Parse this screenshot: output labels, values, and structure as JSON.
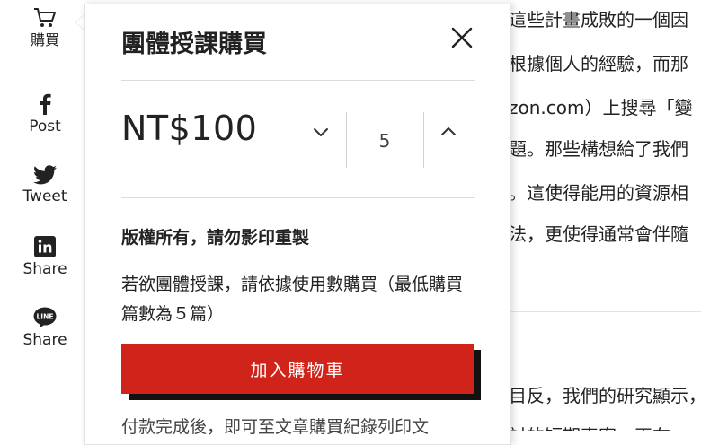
{
  "rail": {
    "cart_label": "購買",
    "facebook_label": "Post",
    "twitter_label": "Tweet",
    "linkedin_label": "Share",
    "line_label": "Share"
  },
  "article": {
    "lines": [
      "這些計畫成敗的一個因",
      "根據個人的經驗，而那",
      "zon.com）上搜尋「變",
      "題。那些構想給了我們",
      "。這使得能用的資源相",
      "法，更使得通常會伴隨",
      "目反，我們的研究顯示，",
      "討的短期專案，再在"
    ]
  },
  "popup": {
    "title": "團體授課購買",
    "price": "NT$100",
    "quantity": "5",
    "copyright_text": "版權所有，請勿影印重製",
    "bulk_text": "若欲團體授課，請依據使用數購買（最低購買篇數為５篇）",
    "add_to_cart_label": "加入購物車",
    "note_text": "付款完成後，即可至文章購買紀錄列印文"
  },
  "colors": {
    "accent": "#d0241b",
    "button_shadow": "#111111",
    "text": "#222222"
  },
  "icons": {
    "cart": "cart-icon",
    "close": "close-icon",
    "decrease": "chevron-down-icon",
    "increase": "chevron-up-icon",
    "facebook": "facebook-icon",
    "twitter": "twitter-icon",
    "linkedin": "linkedin-icon",
    "line": "line-icon"
  }
}
